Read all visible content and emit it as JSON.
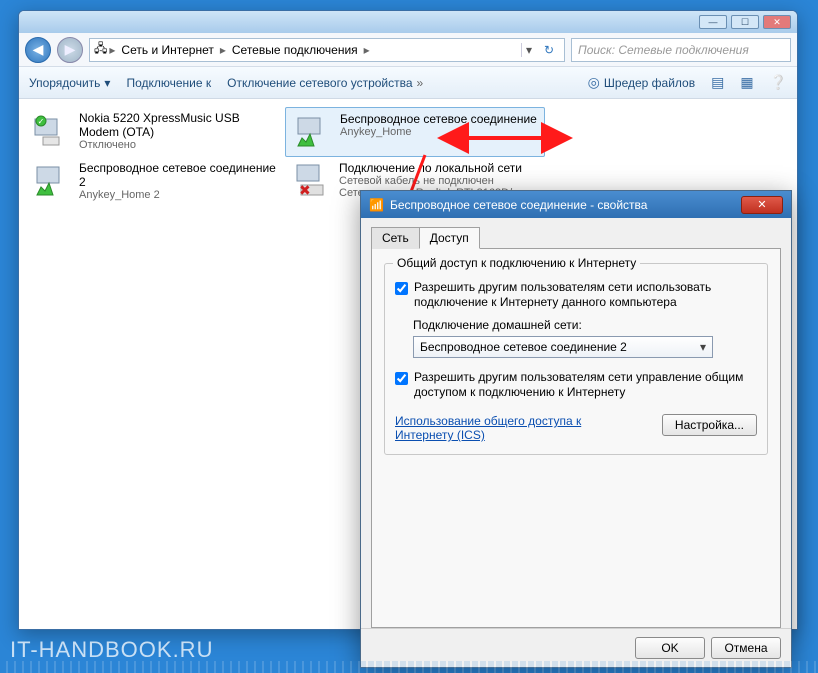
{
  "titlebar": {},
  "nav": {
    "crumb1": "Сеть и Интернет",
    "crumb2": "Сетевые подключения",
    "search_placeholder": "Поиск: Сетевые подключения"
  },
  "toolbar": {
    "organize": "Упорядочить",
    "connect": "Подключение к",
    "disable": "Отключение сетевого устройства",
    "shredder": "Шредер файлов"
  },
  "connections": [
    {
      "name": "Nokia 5220 XpressMusic USB Modem (OTA)",
      "sub": "",
      "status": "Отключено"
    },
    {
      "name": "Беспроводное сетевое соединение",
      "sub": "Anykey_Home",
      "status": ""
    },
    {
      "name": "Беспроводное сетевое соединение 2",
      "sub": "Anykey_Home 2",
      "status": ""
    },
    {
      "name": "Подключение по локальной сети",
      "sub": "Сетевой кабель не подключен",
      "status": "Сетевая карта Realtek RTL8168D/..."
    }
  ],
  "dialog": {
    "title": "Беспроводное сетевое соединение - свойства",
    "tabs": {
      "net": "Сеть",
      "access": "Доступ"
    },
    "group_legend": "Общий доступ к подключению к Интернету",
    "chk1": "Разрешить другим пользователям сети использовать подключение к Интернету данного компьютера",
    "home_label": "Подключение домашней сети:",
    "combo_value": "Беспроводное сетевое соединение 2",
    "chk2": "Разрешить другим пользователям сети управление общим доступом к подключению к Интернету",
    "link": "Использование общего доступа к Интернету (ICS)",
    "settings_btn": "Настройка...",
    "ok": "OK",
    "cancel": "Отмена"
  },
  "watermark": "IT-HANDBOOK.RU"
}
